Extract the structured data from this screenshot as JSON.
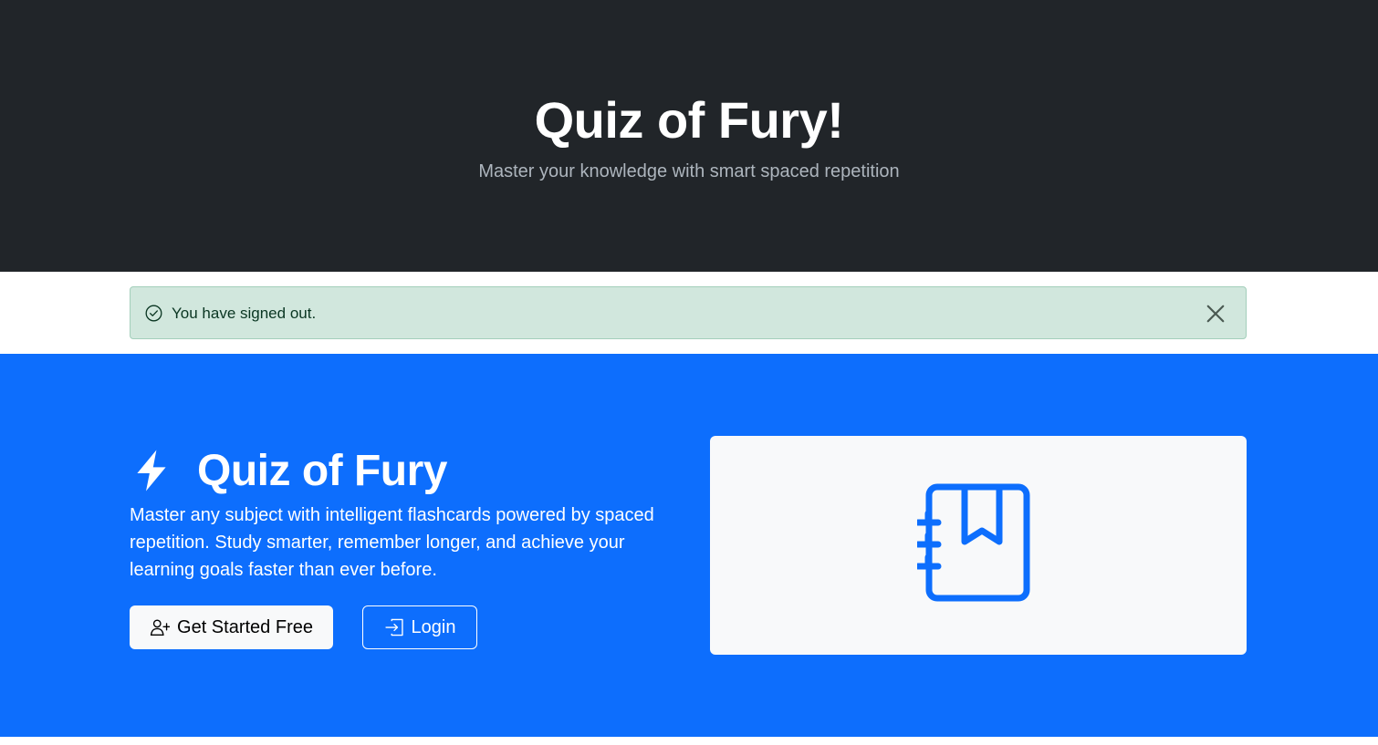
{
  "header": {
    "title": "Quiz of Fury!",
    "subtitle": "Master your knowledge with smart spaced repetition"
  },
  "alert": {
    "message": "You have signed out.",
    "icon": "check-circle-icon",
    "close_icon": "close-icon"
  },
  "hero": {
    "icon": "lightning-icon",
    "title": "Quiz of Fury",
    "lead": "Master any subject with intelligent flashcards powered by spaced repetition. Study smarter, remember longer, and achieve your learning goals faster than ever before.",
    "primary_button": {
      "label": "Get Started Free",
      "icon": "person-plus-icon"
    },
    "secondary_button": {
      "label": "Login",
      "icon": "box-arrow-in-icon"
    },
    "illustration_icon": "journal-bookmark-icon"
  },
  "colors": {
    "dark": "#212529",
    "primary": "#0d6efd",
    "alert_bg": "#d1e7dd",
    "light": "#f8f9fa"
  }
}
